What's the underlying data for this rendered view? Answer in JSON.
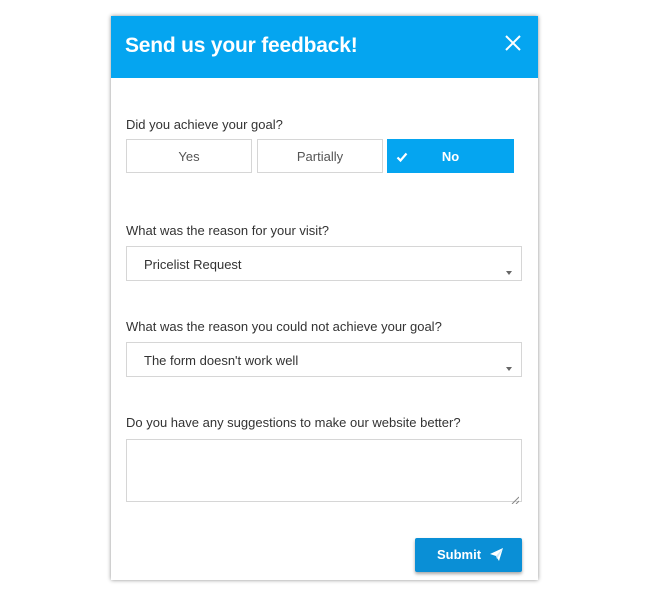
{
  "dialog": {
    "title": "Send us your feedback!",
    "close_icon": "close-icon",
    "accent_color": "#05a5f0"
  },
  "goal": {
    "question": "Did you achieve your goal?",
    "options": [
      "Yes",
      "Partially",
      "No"
    ],
    "selected": "No"
  },
  "visit_reason": {
    "question": "What was the reason for your visit?",
    "value": "Pricelist Request"
  },
  "failure_reason": {
    "question": "What was the reason you could not achieve your goal?",
    "value": "The form doesn't work well"
  },
  "suggestions": {
    "question": "Do you have any suggestions to make our website better?",
    "value": ""
  },
  "submit": {
    "label": "Submit",
    "icon": "paper-plane-icon"
  }
}
